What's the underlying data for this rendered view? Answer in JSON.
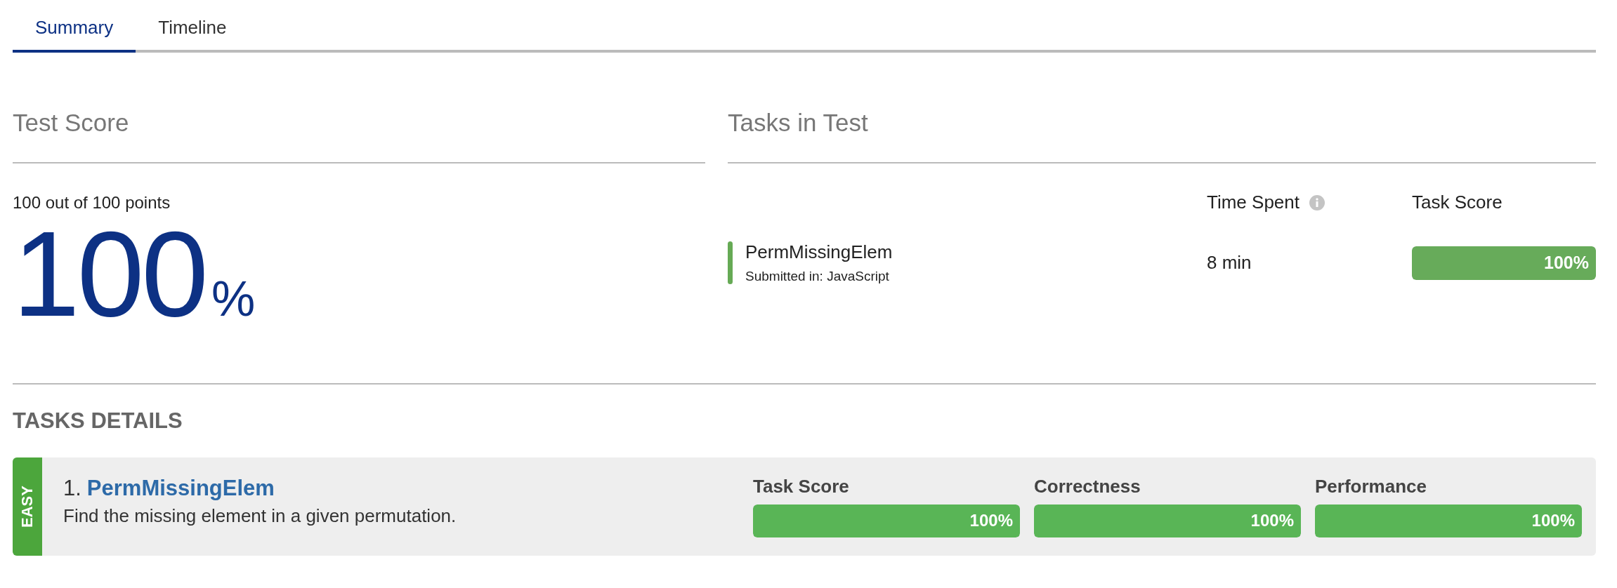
{
  "tabs": [
    {
      "label": "Summary",
      "selected": true
    },
    {
      "label": "Timeline",
      "selected": false
    }
  ],
  "test_score": {
    "heading": "Test Score",
    "points": "100 out of 100 points",
    "percent": "100",
    "percent_sign": "%"
  },
  "tasks_in_test": {
    "heading": "Tasks in Test",
    "columns": {
      "time_spent": "Time Spent",
      "task_score": "Task Score"
    },
    "rows": [
      {
        "name": "PermMissingElem",
        "submitted": "Submitted in: JavaScript",
        "color": "#66aa55",
        "time": "8 min",
        "score": "100%",
        "level": 1
      }
    ]
  },
  "tasks_details": {
    "heading": "TASKS DETAILS",
    "tasks": [
      {
        "difficulty": "EASY",
        "number": "1.",
        "name": "PermMissingElem",
        "description": "Find the missing element in a given permutation.",
        "metrics": [
          {
            "label": "Task Score",
            "value": "100%",
            "level": 1
          },
          {
            "label": "Correctness",
            "value": "100%",
            "level": 1
          },
          {
            "label": "Performance",
            "value": "100%",
            "level": 1
          }
        ]
      }
    ]
  }
}
